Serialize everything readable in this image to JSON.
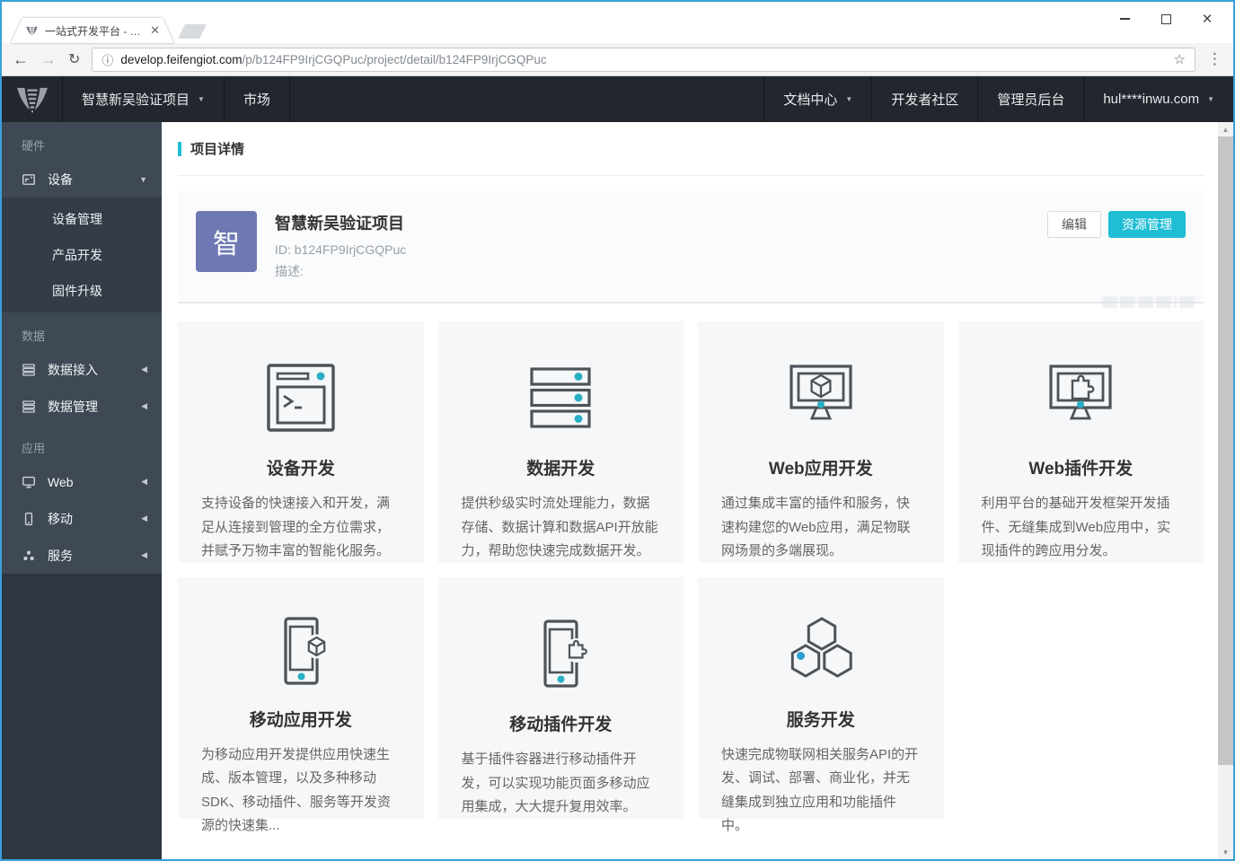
{
  "browser": {
    "tab_title": "一站式开发平台 - 项目",
    "url_host": "develop.feifengiot.com",
    "url_path": "/p/b124FP9IrjCGQPuc/project/detail/b124FP9IrjCGQPuc"
  },
  "icons": {
    "caret_down": "▼",
    "caret_left": "◀",
    "tab_close": "✕",
    "window_close": "×",
    "back": "←",
    "forward": "→",
    "reload": "↻",
    "info": "ⓘ",
    "star": "☆",
    "menu_dots": "⋮",
    "scroll_up": "▲",
    "scroll_down": "▼"
  },
  "navbar": {
    "project_selector": "智慧新吴验证项目",
    "market": "市场",
    "doc_center": "文档中心",
    "community": "开发者社区",
    "admin_console": "管理员后台",
    "account": "hul****inwu.com"
  },
  "sidebar": {
    "section_hardware": "硬件",
    "device": "设备",
    "device_children": [
      "设备管理",
      "产品开发",
      "固件升级"
    ],
    "section_data": "数据",
    "data_access": "数据接入",
    "data_manage": "数据管理",
    "section_app": "应用",
    "web": "Web",
    "mobile": "移动",
    "service": "服务"
  },
  "main": {
    "breadcrumb": "项目详情",
    "project": {
      "avatar_letter": "智",
      "name": "智慧新吴验证项目",
      "id_line": "ID: b124FP9IrjCGQPuc",
      "desc_label": "描述:",
      "edit_button": "编辑",
      "resource_button": "资源管理"
    },
    "cards": [
      {
        "title": "设备开发",
        "desc": "支持设备的快速接入和开发，满足从连接到管理的全方位需求，并赋予万物丰富的智能化服务。"
      },
      {
        "title": "数据开发",
        "desc": "提供秒级实时流处理能力，数据存储、数据计算和数据API开放能力，帮助您快速完成数据开发。"
      },
      {
        "title": "Web应用开发",
        "desc": "通过集成丰富的插件和服务，快速构建您的Web应用，满足物联网场景的多端展现。"
      },
      {
        "title": "Web插件开发",
        "desc": "利用平台的基础开发框架开发插件、无缝集成到Web应用中，实现插件的跨应用分发。"
      },
      {
        "title": "移动应用开发",
        "desc": "为移动应用开发提供应用快速生成、版本管理，以及多种移动SDK、移动插件、服务等开发资源的快速集..."
      },
      {
        "title": "移动插件开发",
        "desc": "基于插件容器进行移动插件开发，可以实现功能页面多移动应用集成，大大提升复用效率。"
      },
      {
        "title": "服务开发",
        "desc": "快速完成物联网相关服务API的开发、调试、部署、商业化，并无缝集成到独立应用和功能插件中。"
      }
    ]
  },
  "colors": {
    "accent_teal": "#1fbed5",
    "icon_dot_teal": "#29afc3",
    "avatar_purple": "#6e79b4",
    "navbar_bg": "#22272e",
    "sidebar_bg": "#3e4955",
    "sidebar_submenu_bg": "#333c47",
    "card_bg": "#f6f7f8",
    "window_border_blue": "#38a0d8"
  }
}
